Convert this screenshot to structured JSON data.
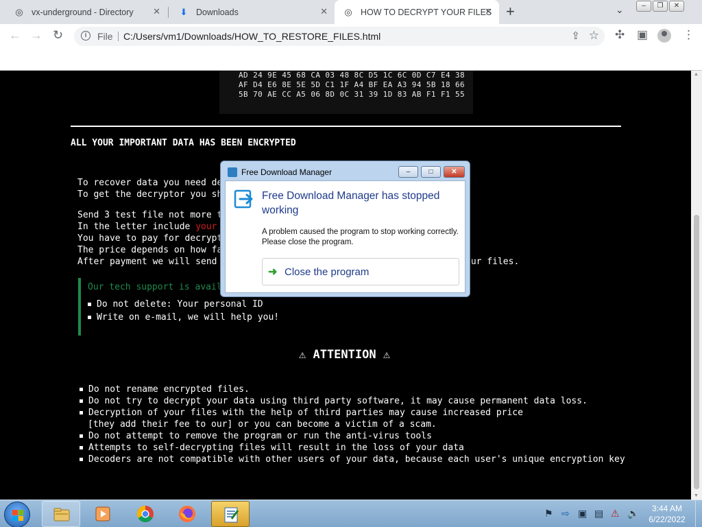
{
  "browser": {
    "tabs": [
      {
        "label": "vx-underground - Directory",
        "icon": "globe-icon",
        "active": false
      },
      {
        "label": "Downloads",
        "icon": "download-icon",
        "active": false
      },
      {
        "label": "HOW TO DECRYPT YOUR FILES",
        "icon": "globe-icon",
        "active": true
      }
    ],
    "scheme_label": "File",
    "url": "C:/Users/vm1/Downloads/HOW_TO_RESTORE_FILES.html"
  },
  "page": {
    "hex_lines": [
      "AD 24 9E 45 68 CA 03 48 8C D5 1C 6C 0D C7 E4 38",
      "AF D4 E6 8E 5E 5D C1 1F A4 BF EA A3 94 5B 18 66",
      "5B 70 AE CC A5 06 8D 0C 31 39 1D 83 AB F1 F1 55"
    ],
    "headline": "ALL YOUR IMPORTANT DATA HAS BEEN ENCRYPTED",
    "para1": [
      "To recover data you need de",
      "To get the decryptor you sh"
    ],
    "para2": {
      "line1": "Send 3 test file not more t",
      "line2_prefix": "In the letter include ",
      "line2_red": "your",
      "line3": "You have to pay for decrypt",
      "line4": "The price depends on how fa",
      "line5": "After payment we will send",
      "line5_tail": "our files."
    },
    "support": {
      "heading": "Our tech support is avail",
      "items": [
        "Do not delete: Your personal ID",
        "Write on e-mail, we will help you!"
      ]
    },
    "attention_title": "⚠ ATTENTION ⚠",
    "warnings": [
      "Do not rename encrypted files.",
      "Do not try to decrypt your data using third party software, it may cause permanent data loss.",
      "Decryption of your files with the help of third parties may cause increased price",
      "[they add their fee to our] or you can become a victim of a scam.",
      "Do not attempt to remove the program or run the anti-virus tools",
      "Attempts to self-decrypting files will result in the loss of your data",
      "Decoders are not compatible with other users of your data, because each user's unique encryption key"
    ]
  },
  "dialog": {
    "title": "Free Download Manager",
    "heading": "Free Download Manager has stopped working",
    "message": "A problem caused the program to stop working correctly. Please close the program.",
    "action_label": "Close the program"
  },
  "taskbar": {
    "apps": [
      "explorer-icon",
      "media-player-icon",
      "chrome-icon",
      "firefox-icon",
      "notepad-icon"
    ],
    "time": "3:44 AM",
    "date": "6/22/2022"
  },
  "colors": {
    "page_bg": "#000000",
    "support_accent": "#1f8a4c",
    "red_text": "#d21f1f",
    "dialog_heading": "#1e3a8a"
  }
}
